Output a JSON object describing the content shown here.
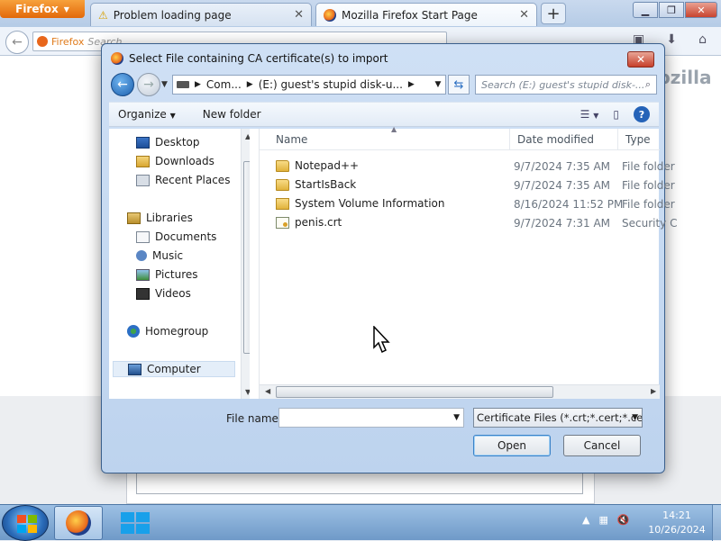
{
  "browser": {
    "menu_label": "Firefox",
    "tabs": [
      {
        "title": "Problem loading page"
      },
      {
        "title": "Mozilla Firefox Start Page"
      }
    ],
    "url_prefix": "Firefox",
    "url_placeholder": "Search",
    "logo_text": "ozilla"
  },
  "dialog": {
    "title": "Select File containing CA certificate(s) to import",
    "address_parts": [
      "Com...",
      "(E:) guest's stupid disk-u..."
    ],
    "search_placeholder": "Search (E:) guest's stupid disk-...",
    "toolbar": {
      "organize": "Organize",
      "new_folder": "New folder"
    },
    "nav": {
      "favorites": [
        "Desktop",
        "Downloads",
        "Recent Places"
      ],
      "libraries_label": "Libraries",
      "libraries": [
        "Documents",
        "Music",
        "Pictures",
        "Videos"
      ],
      "homegroup": "Homegroup",
      "computer": "Computer"
    },
    "columns": {
      "name": "Name",
      "date": "Date modified",
      "type": "Type"
    },
    "files": [
      {
        "name": "Notepad++",
        "date": "9/7/2024 7:35 AM",
        "type": "File folder",
        "icon": "folder-icon"
      },
      {
        "name": "StartIsBack",
        "date": "9/7/2024 7:35 AM",
        "type": "File folder",
        "icon": "folder-icon"
      },
      {
        "name": "System Volume Information",
        "date": "8/16/2024 11:52 PM",
        "type": "File folder",
        "icon": "locked-folder-icon"
      },
      {
        "name": "penis.crt",
        "date": "9/7/2024 7:31 AM",
        "type": "Security C",
        "icon": "certificate-icon"
      }
    ],
    "filename_label": "File name:",
    "filename_value": "",
    "filetype": "Certificate Files (*.crt;*.cert;*.ce",
    "open_label": "Open",
    "cancel_label": "Cancel"
  },
  "taskbar": {
    "time": "14:21",
    "date": "10/26/2024"
  },
  "colors": {
    "dialog_border": "#3a5f8c",
    "close_red": "#c7402b",
    "selection": "#e4eef9",
    "taskbar": "#6f9ac8"
  }
}
